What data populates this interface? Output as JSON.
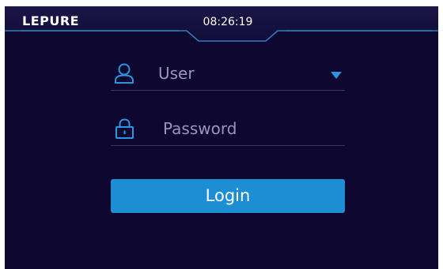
{
  "header": {
    "logo_text": "LEPURE",
    "time": "08:26:19"
  },
  "form": {
    "user_label": "User",
    "password_label": "Password",
    "login_label": "Login"
  },
  "colors": {
    "background": "#0e0830",
    "accent": "#1d8ed3",
    "header_line": "#2f7fc0",
    "placeholder": "#9a96b8"
  },
  "icons": {
    "user": "user-icon",
    "password": "lock-icon",
    "dropdown": "caret-down-icon"
  }
}
